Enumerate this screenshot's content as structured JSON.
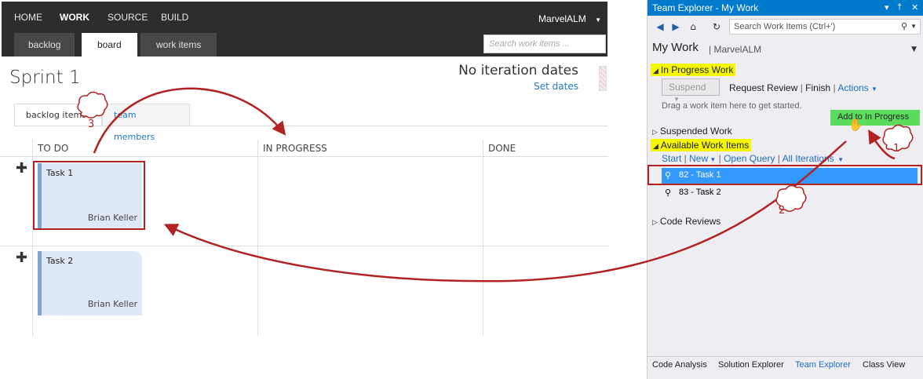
{
  "web": {
    "nav": [
      "HOME",
      "WORK",
      "SOURCE",
      "BUILD"
    ],
    "account": "MarvelALM",
    "hub_tabs": [
      "backlog",
      "board",
      "work items"
    ],
    "search_placeholder": "Search work items ...",
    "sprint_title": "Sprint 1",
    "iteration_dates": "No iteration dates",
    "set_dates": "Set dates",
    "sub_tabs": [
      "backlog items",
      "team members"
    ],
    "columns": [
      "TO DO",
      "IN PROGRESS",
      "DONE"
    ],
    "cards": [
      {
        "title": "Task 1",
        "owner": "Brian Keller"
      },
      {
        "title": "Task 2",
        "owner": "Brian Keller"
      }
    ]
  },
  "te": {
    "title": "Team Explorer - My Work",
    "search_placeholder": "Search Work Items (Ctrl+')",
    "heading": "My Work",
    "project": "MarvelALM",
    "in_progress": "In Progress Work",
    "suspend": "Suspend",
    "request_review": "Request Review",
    "finish": "Finish",
    "actions": "Actions",
    "drag_hint": "Drag a work item here to get started.",
    "add_to_progress": "Add to In Progress",
    "suspended": "Suspended Work",
    "available": "Available Work Items",
    "available_links": [
      "Start",
      "New",
      "Open Query",
      "All Iterations"
    ],
    "items": [
      "82 - Task 1",
      "83 - Task 2"
    ],
    "code_reviews": "Code Reviews",
    "footer_tabs": [
      "Code Analysis",
      "Solution Explorer",
      "Team Explorer",
      "Class View"
    ]
  },
  "annotations": [
    "1",
    "2",
    "3"
  ]
}
